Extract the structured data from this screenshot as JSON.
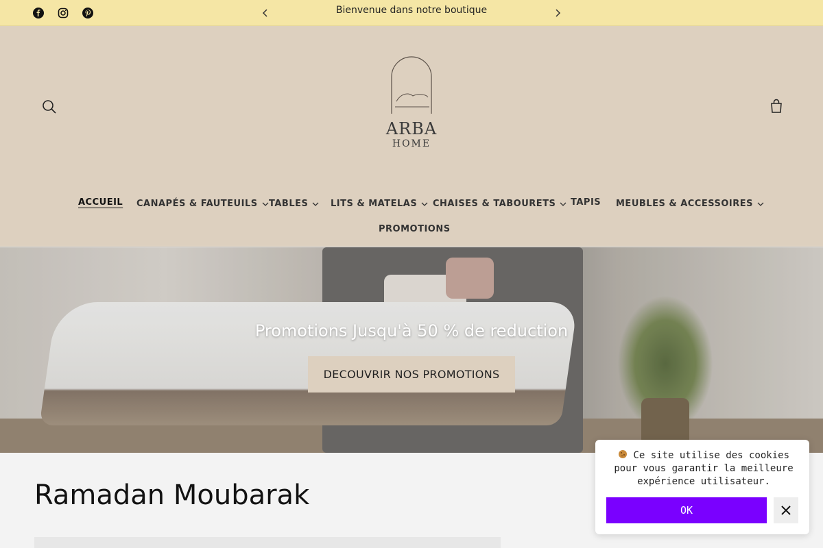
{
  "announcement": {
    "text": "Bienvenue dans notre boutique",
    "prev_icon": "chevron-left-icon",
    "next_icon": "chevron-right-icon"
  },
  "social": [
    "facebook-icon",
    "instagram-icon",
    "pinterest-icon"
  ],
  "header": {
    "logo_line1": "ARBA",
    "logo_line2": "HOME",
    "search_icon": "search-icon",
    "cart_icon": "cart-icon"
  },
  "nav": {
    "items": [
      {
        "label": "ACCUEIL",
        "active": true,
        "dropdown": false
      },
      {
        "label": "CANAPÉS & FAUTEUILS",
        "dropdown": true
      },
      {
        "label": "TABLES",
        "dropdown": true
      },
      {
        "label": "LITS & MATELAS",
        "dropdown": true
      },
      {
        "label": "CHAISES & TABOURETS",
        "dropdown": true
      },
      {
        "label": "TAPIS",
        "dropdown": false
      },
      {
        "label": "MEUBLES & ACCESSOIRES",
        "dropdown": true
      },
      {
        "label": "PROMOTIONS",
        "dropdown": false
      }
    ]
  },
  "hero": {
    "title": "Promotions Jusqu'à 50 % de reduction",
    "button": "DECOUVRIR NOS PROMOTIONS"
  },
  "content": {
    "title": "Ramadan Moubarak"
  },
  "cookie": {
    "text": "Ce site utilise des cookies pour vous garantir la meilleure expérience utilisateur.",
    "ok": "OK",
    "close_icon": "close-icon",
    "cookie_icon": "cookie-icon"
  },
  "colors": {
    "announcement_bg": "#f5e6a5",
    "header_bg": "#ddd0bf",
    "button_bg": "#ddd0bf",
    "cookie_ok_bg": "#7a00ff"
  }
}
